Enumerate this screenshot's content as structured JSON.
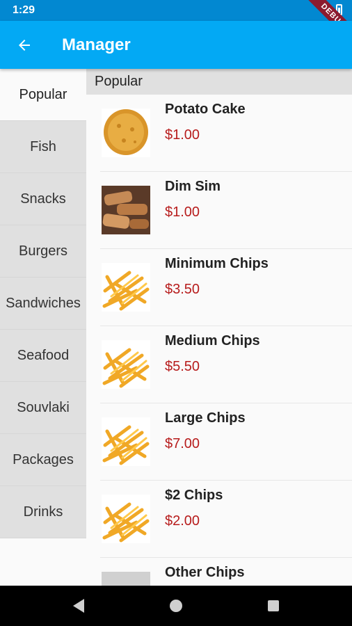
{
  "status_bar": {
    "time": "1:29",
    "debug_label": "DEBUG"
  },
  "app_bar": {
    "title": "Manager",
    "back_icon": "arrow-back-icon"
  },
  "sidebar": {
    "items": [
      {
        "label": "Popular",
        "active": true
      },
      {
        "label": "Fish"
      },
      {
        "label": "Snacks"
      },
      {
        "label": "Burgers"
      },
      {
        "label": "Sandwiches"
      },
      {
        "label": "Seafood"
      },
      {
        "label": "Souvlaki"
      },
      {
        "label": "Packages"
      },
      {
        "label": "Drinks"
      }
    ]
  },
  "section": {
    "title": "Popular"
  },
  "products": [
    {
      "name": "Potato Cake",
      "price": "$1.00",
      "image": "potato-cake"
    },
    {
      "name": "Dim Sim",
      "price": "$1.00",
      "image": "dim-sim"
    },
    {
      "name": "Minimum Chips",
      "price": "$3.50",
      "image": "chips"
    },
    {
      "name": "Medium Chips",
      "price": "$5.50",
      "image": "chips"
    },
    {
      "name": "Large Chips",
      "price": "$7.00",
      "image": "chips"
    },
    {
      "name": "$2 Chips",
      "price": "$2.00",
      "image": "chips"
    },
    {
      "name": "Other Chips",
      "price": "",
      "image": "placeholder"
    }
  ],
  "colors": {
    "primary": "#03a9f4",
    "primary_dark": "#0288d1",
    "price": "#b71c1c"
  }
}
